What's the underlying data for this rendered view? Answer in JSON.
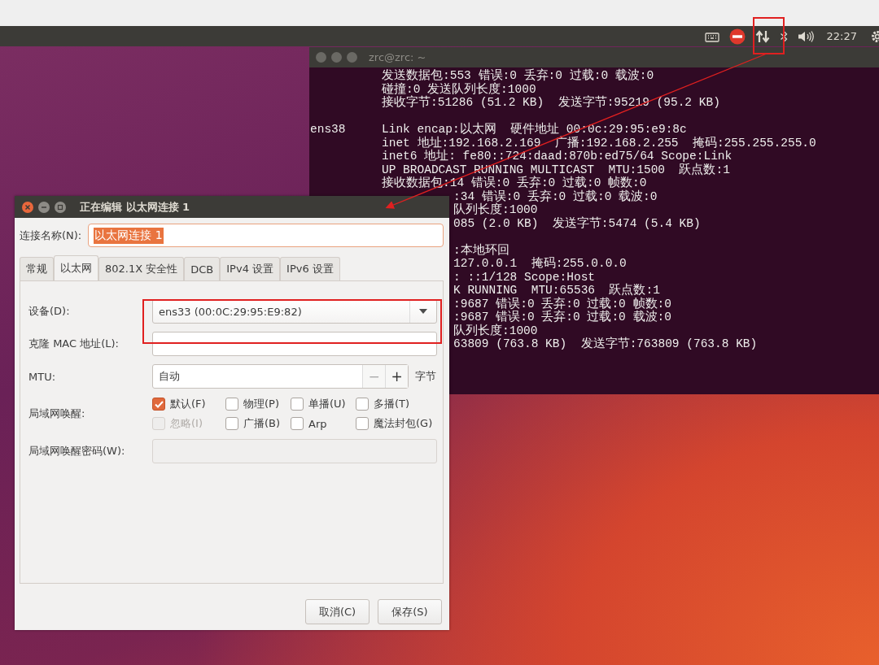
{
  "top_panel": {
    "clock": "22:27"
  },
  "terminal": {
    "title": "zrc@zrc: ~",
    "lines": [
      {
        "kind": "full",
        "text": "发送数据包:553 错误:0 丢弃:0 过载:0 载波:0"
      },
      {
        "kind": "full",
        "text": "碰撞:0 发送队列长度:1000"
      },
      {
        "kind": "full",
        "text": "接收字节:51286 (51.2 KB)  发送字节:95219 (95.2 KB)"
      },
      {
        "kind": "blank"
      },
      {
        "kind": "iface",
        "iface": "ens38",
        "text": "Link encap:以太网  硬件地址 00:0c:29:95:e9:8c"
      },
      {
        "kind": "full",
        "text": "inet 地址:192.168.2.169  广播:192.168.2.255  掩码:255.255.255.0"
      },
      {
        "kind": "full",
        "text": "inet6 地址: fe80::724:daad:870b:ed75/64 Scope:Link"
      },
      {
        "kind": "full",
        "text": "UP BROADCAST RUNNING MULTICAST  MTU:1500  跃点数:1"
      },
      {
        "kind": "full",
        "text": "接收数据包:14 错误:0 丢弃:0 过载:0 帧数:0"
      },
      {
        "kind": "partial",
        "text": ":34 错误:0 丢弃:0 过载:0 载波:0"
      },
      {
        "kind": "partial",
        "text": "队列长度:1000"
      },
      {
        "kind": "partial",
        "text": "085 (2.0 KB)  发送字节:5474 (5.4 KB)"
      },
      {
        "kind": "blank"
      },
      {
        "kind": "partial",
        "text": ":本地环回"
      },
      {
        "kind": "partial",
        "text": "127.0.0.1  掩码:255.0.0.0"
      },
      {
        "kind": "partial",
        "text": ": ::1/128 Scope:Host"
      },
      {
        "kind": "partial",
        "text": "K RUNNING  MTU:65536  跃点数:1"
      },
      {
        "kind": "partial",
        "text": ":9687 错误:0 丢弃:0 过载:0 帧数:0"
      },
      {
        "kind": "partial",
        "text": ":9687 错误:0 丢弃:0 过载:0 载波:0"
      },
      {
        "kind": "partial",
        "text": "队列长度:1000"
      },
      {
        "kind": "partial",
        "text": "63809 (763.8 KB)  发送字节:763809 (763.8 KB)"
      }
    ]
  },
  "dialog": {
    "title": "正在编辑 以太网连接 1",
    "name_label": "连接名称(N):",
    "name_value": "以太网连接 1",
    "tabs": [
      {
        "label": "常规",
        "selected": false
      },
      {
        "label": "以太网",
        "selected": true
      },
      {
        "label": "802.1X 安全性",
        "selected": false
      },
      {
        "label": "DCB",
        "selected": false
      },
      {
        "label": "IPv4 设置",
        "selected": false
      },
      {
        "label": "IPv6 设置",
        "selected": false
      }
    ],
    "device": {
      "label": "设备(D):",
      "value": "ens33 (00:0C:29:95:E9:82)"
    },
    "clone_mac": {
      "label": "克隆 MAC 地址(L):"
    },
    "mtu": {
      "label": "MTU:",
      "value": "自动",
      "minus": "−",
      "plus": "+",
      "unit": "字节"
    },
    "wake_on_lan": {
      "label": "局域网唤醒:",
      "options": [
        {
          "label": "默认(F)",
          "checked": true,
          "disabled": false
        },
        {
          "label": "物理(P)",
          "checked": false,
          "disabled": false
        },
        {
          "label": "单播(U)",
          "checked": false,
          "disabled": false
        },
        {
          "label": "多播(T)",
          "checked": false,
          "disabled": false
        },
        {
          "label": "忽略(I)",
          "checked": false,
          "disabled": true
        },
        {
          "label": "广播(B)",
          "checked": false,
          "disabled": false
        },
        {
          "label": "Arp",
          "checked": false,
          "disabled": false
        },
        {
          "label": "魔法封包(G)",
          "checked": false,
          "disabled": false
        }
      ]
    },
    "wake_password": {
      "label": "局域网唤醒密码(W):"
    },
    "buttons": [
      "取消(C)",
      "保存(S)"
    ]
  }
}
